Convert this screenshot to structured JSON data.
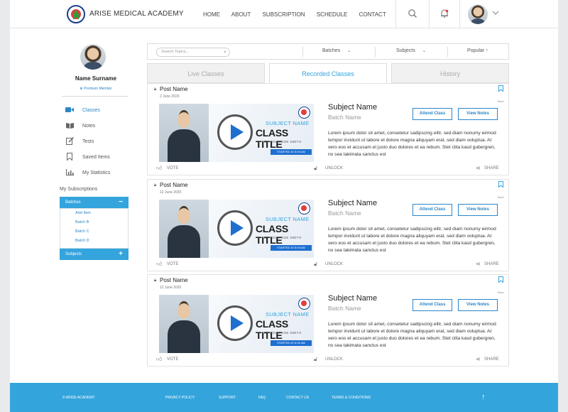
{
  "header": {
    "brand": "ARISE MEDICAL ACADEMY",
    "nav": [
      "HOME",
      "ABOUT",
      "SUBSCRIPTION",
      "SCHEDULE",
      "CONTACT"
    ],
    "icons": [
      "search-icon",
      "bell-icon",
      "chevron-down-icon"
    ]
  },
  "sidebar": {
    "name": "Name Surname",
    "member": "Premium Member",
    "menu": [
      {
        "label": "Classes",
        "icon": "video-icon"
      },
      {
        "label": "Notes",
        "icon": "book-icon"
      },
      {
        "label": "Tests",
        "icon": "edit-icon"
      },
      {
        "label": "Saved Items",
        "icon": "bookmark-icon"
      },
      {
        "label": "My Statistics",
        "icon": "chart-icon"
      }
    ],
    "subs_title": "My Subscriptions",
    "batches_label": "Batches",
    "batch_items": [
      "Add Item",
      "Batch B",
      "Batch C",
      "Batch D"
    ],
    "subjects_label": "Subjects"
  },
  "filters": {
    "search_placeholder": "Search Topics...",
    "batches": "Batches",
    "subjects": "Subjects",
    "sort": "Popular ↑"
  },
  "tabs": [
    "Live Classes",
    "Recorded Classes",
    "History"
  ],
  "cards": [
    {
      "post_name": "Post Name",
      "date": "2 June 2020",
      "save": "Save",
      "subject_name": "Subject Name",
      "batch_name": "Batch Name",
      "attend": "Attend Class",
      "view_notes": "View Notes",
      "thumb_subject": "SUBJECT NAME",
      "thumb_title": "CLASS TITLE",
      "thumb_by": "BY JOHN DOE SMITH",
      "thumb_started": "STARTED AT 8:00 AM",
      "desc": "Lorem ipsum dolor sit amet, consetetur sadipscing elitr, sed diam nonumy eirmod tempor invidunt ut labore et dolore magna aliquyam erat, sed diam voluptua. At vero eos et accusam et justo duo dolores et ea rebum. Stet clita kasd gubergren, no sea takimata sanctus est",
      "vote": "VOTE",
      "unlock": "UNLOCK",
      "share": "SHARE"
    },
    {
      "post_name": "Post Name",
      "date": "12 June 2020",
      "save": "Save",
      "subject_name": "Subject Name",
      "batch_name": "Batch Name",
      "attend": "Attend Class",
      "view_notes": "View Notes",
      "thumb_subject": "SUBJECT NAME",
      "thumb_title": "CLASS TITLE",
      "thumb_by": "BY JOHN DOE SMITH",
      "thumb_started": "STARTED AT 8:00 AM",
      "desc": "Lorem ipsum dolor sit amet, consetetur sadipscing elitr, sed diam nonumy eirmod tempor invidunt ut labore et dolore magna aliquyam erat, sed diam voluptua. At vero eos et accusam et justo duo dolores et ea rebum. Stet clita kasd gubergren, no sea takimata sanctus est",
      "vote": "VOTE",
      "unlock": "UNLOCK",
      "share": "SHARE"
    },
    {
      "post_name": "Post Name",
      "date": "12 June 2020",
      "save": "Save",
      "subject_name": "Subject Name",
      "batch_name": "Batch Name",
      "attend": "Attend Class",
      "view_notes": "View Notes",
      "thumb_subject": "SUBJECT NAME",
      "thumb_title": "CLASS TITLE",
      "thumb_by": "BY JOHN DOE SMITH",
      "thumb_started": "STARTED AT 8:00 AM",
      "desc": "Lorem ipsum dolor sit amet, consetetur sadipscing elitr, sed diam nonumy eirmod tempor invidunt ut labore et dolore magna aliquyam erat, sed diam voluptua. At vero eos et accusam et justo duo dolores et ea rebum. Stet clita kasd gubergren, no sea takimata sanctus est",
      "vote": "VOTE",
      "unlock": "UNLOCK",
      "share": "SHARE"
    }
  ],
  "footer": {
    "copyright": "© ARISE ACADEMY",
    "links": [
      "PRIVACY POLICY",
      "SUPPORT",
      "FAQ",
      "CONTACT US",
      "TERMS & CONDITIONS"
    ]
  },
  "colors": {
    "accent": "#34a4dc",
    "button": "#2a86c8",
    "play": "#1e6fd0"
  }
}
